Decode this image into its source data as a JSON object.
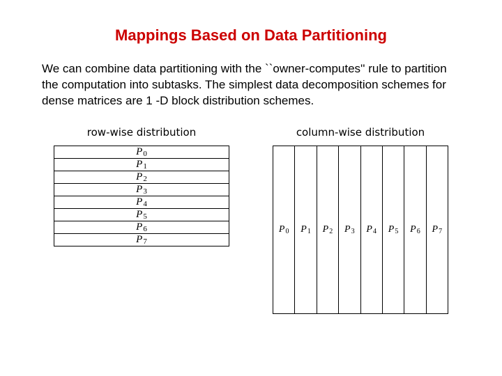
{
  "title": "Mappings Based on Data Partitioning",
  "body": "We can combine data partitioning with the ``owner-computes'' rule to partition the computation into subtasks. The simplest data decomposition schemes for dense matrices are 1 -D block distribution schemes.",
  "row_caption": "row-wise distribution",
  "col_caption": "column-wise distribution",
  "proc_symbol": "P",
  "procs": [
    "0",
    "1",
    "2",
    "3",
    "4",
    "5",
    "6",
    "7"
  ]
}
